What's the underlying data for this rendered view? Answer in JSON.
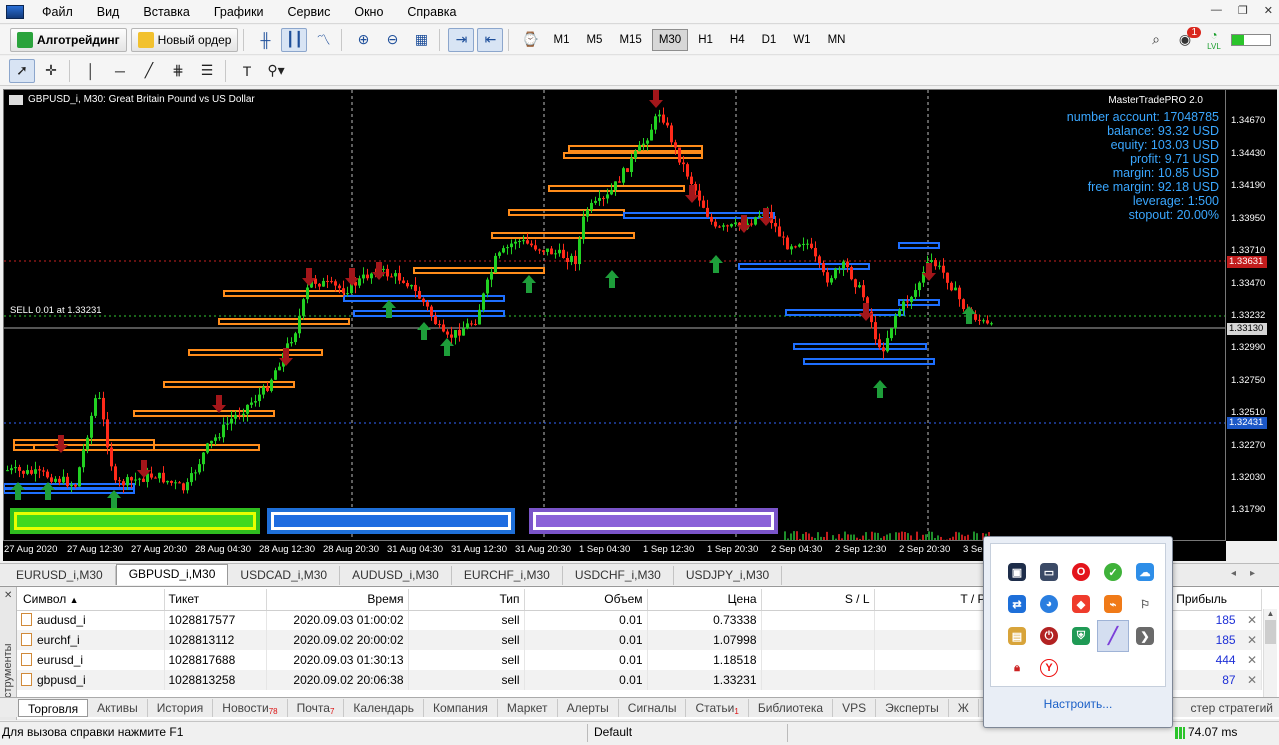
{
  "menu": [
    "Файл",
    "Вид",
    "Вставка",
    "Графики",
    "Сервис",
    "Окно",
    "Справка"
  ],
  "toolbar": {
    "algotrading": "Алготрейдинг",
    "new_order": "Новый ордер",
    "timeframes": [
      "M1",
      "M5",
      "M15",
      "M30",
      "H1",
      "H4",
      "D1",
      "W1",
      "MN"
    ],
    "active_timeframe": "M30",
    "notification_count": "1",
    "lvl_badge": "LVL"
  },
  "chart": {
    "title": "GBPUSD_i, M30:  Great Britain Pound vs US Dollar",
    "indicator_name": "MasterTradePRO 2.0",
    "sell_label": "SELL 0.01 at 1.33231",
    "account_info": [
      "number account: 17048785",
      "balance: 93.32 USD",
      "equity: 103.03 USD",
      "profit: 9.71 USD",
      "margin: 10.85 USD",
      "free margin: 92.18 USD",
      "leverage: 1:500",
      "stopout: 20.00%"
    ],
    "price_ticks": [
      "1.34670",
      "1.34430",
      "1.34190",
      "1.33950",
      "1.33710",
      "1.33470",
      "1.33232",
      "1.32990",
      "1.32750",
      "1.32510",
      "1.32270",
      "1.32030",
      "1.31790"
    ],
    "price_marker_red": "1.33631",
    "price_marker_current": "1.33130",
    "price_marker_blue": "1.32431",
    "time_ticks": [
      "27 Aug 2020",
      "27 Aug 12:30",
      "27 Aug 20:30",
      "28 Aug 04:30",
      "28 Aug 12:30",
      "28 Aug 20:30",
      "31 Aug 04:30",
      "31 Aug 12:30",
      "31 Aug 20:30",
      "1 Sep 04:30",
      "1 Sep 12:30",
      "1 Sep 20:30",
      "2 Sep 04:30",
      "2 Sep 12:30",
      "2 Sep 20:30",
      "3 Se"
    ],
    "colors": {
      "buy_level": "#1e6fff",
      "sell_level": "#ff8c1a",
      "up_candle": "#22d122",
      "down_candle": "#ff2a1a",
      "account_text": "#3aa7ff"
    }
  },
  "chart_tabs": [
    "EURUSD_i,M30",
    "GBPUSD_i,M30",
    "USDCAD_i,M30",
    "AUDUSD_i,M30",
    "EURCHF_i,M30",
    "USDCHF_i,M30",
    "USDJPY_i,M30"
  ],
  "active_chart_tab": "GBPUSD_i,M30",
  "terminal": {
    "side_label": "Инструменты",
    "columns": [
      "Символ",
      "Тикет",
      "Время",
      "Тип",
      "Объем",
      "Цена",
      "S / L",
      "T / P",
      "Прибыль"
    ],
    "rows": [
      {
        "symbol": "audusd_i",
        "ticket": "1028817577",
        "time": "2020.09.03 01:00:02",
        "type": "sell",
        "volume": "0.01",
        "price": "0.73338",
        "profit": "185"
      },
      {
        "symbol": "eurchf_i",
        "ticket": "1028813112",
        "time": "2020.09.02 20:00:02",
        "type": "sell",
        "volume": "0.01",
        "price": "1.07998",
        "profit": "185"
      },
      {
        "symbol": "eurusd_i",
        "ticket": "1028817688",
        "time": "2020.09.03 01:30:13",
        "type": "sell",
        "volume": "0.01",
        "price": "1.18518",
        "profit": "444"
      },
      {
        "symbol": "gbpusd_i",
        "ticket": "1028813258",
        "time": "2020.09.02 20:06:38",
        "type": "sell",
        "volume": "0.01",
        "price": "1.33231",
        "profit": "87"
      }
    ],
    "tabs": [
      {
        "label": "Торговля",
        "badge": ""
      },
      {
        "label": "Активы",
        "badge": ""
      },
      {
        "label": "История",
        "badge": ""
      },
      {
        "label": "Новости",
        "badge": "78"
      },
      {
        "label": "Почта",
        "badge": "7"
      },
      {
        "label": "Календарь",
        "badge": ""
      },
      {
        "label": "Компания",
        "badge": ""
      },
      {
        "label": "Маркет",
        "badge": ""
      },
      {
        "label": "Алерты",
        "badge": ""
      },
      {
        "label": "Сигналы",
        "badge": ""
      },
      {
        "label": "Статьи",
        "badge": "1"
      },
      {
        "label": "Библиотека",
        "badge": ""
      },
      {
        "label": "VPS",
        "badge": ""
      },
      {
        "label": "Эксперты",
        "badge": ""
      },
      {
        "label": "Ж",
        "badge": ""
      }
    ],
    "tester_tab": "стер стратегий"
  },
  "status": {
    "help_text": "Для вызова справки нажмите F1",
    "profile": "Default",
    "traffic": "74.07 ms"
  },
  "tray_popup": {
    "icons": [
      "monitor-icon",
      "laptop-icon",
      "opera-icon",
      "check-icon",
      "cloud-icon",
      "teamviewer-icon",
      "chrome-icon",
      "anydesk-icon",
      "usb-icon",
      "flag-icon",
      "photos-icon",
      "power-icon",
      "shield-icon",
      "pen-icon",
      "arrow-icon",
      "lock-icon",
      "yandex-icon"
    ],
    "customize_link": "Настроить..."
  }
}
